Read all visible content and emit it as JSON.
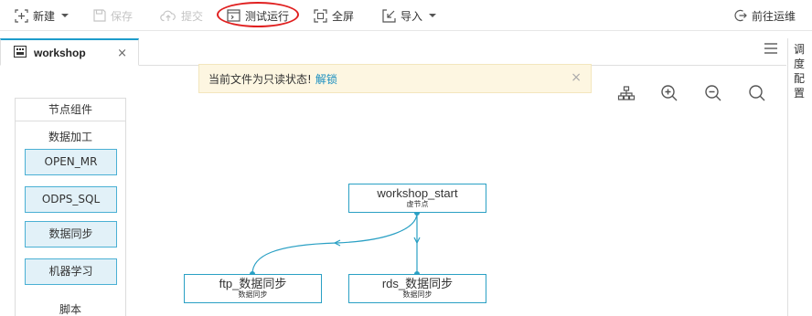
{
  "toolbar": {
    "new_label": "新建",
    "save_label": "保存",
    "submit_label": "提交",
    "test_run_label": "测试运行",
    "fullscreen_label": "全屏",
    "import_label": "导入",
    "goto_ops_label": "前往运维"
  },
  "tabs": [
    {
      "label": "workshop",
      "close": "×"
    }
  ],
  "right_panel": {
    "label": "调度配置"
  },
  "left_panel": {
    "header": "节点组件",
    "section1": "数据加工",
    "items": [
      {
        "label": "OPEN_MR"
      },
      {
        "label": "ODPS_SQL"
      },
      {
        "label": "数据同步"
      },
      {
        "label": "机器学习"
      }
    ],
    "section2": "脚本"
  },
  "notice": {
    "text": "当前文件为只读状态!",
    "link": "解锁",
    "close": "×"
  },
  "canvas": {
    "tools": [
      "layout-tree-icon",
      "zoom-in-icon",
      "zoom-out-icon",
      "search-icon"
    ],
    "nodes": [
      {
        "id": "start",
        "title": "workshop_start",
        "subtitle": "虚节点"
      },
      {
        "id": "ftp",
        "title": "ftp_数据同步",
        "subtitle": "数据同步"
      },
      {
        "id": "rds",
        "title": "rds_数据同步",
        "subtitle": "数据同步"
      }
    ],
    "edges": [
      {
        "from": "start",
        "to": "ftp"
      },
      {
        "from": "start",
        "to": "rds"
      }
    ]
  },
  "colors": {
    "accent": "#1e9ccb",
    "node_border": "#2aa0c4",
    "component_fill": "#e2f1f8",
    "notice_bg": "#fdf6e1",
    "highlight": "#e02020",
    "link": "#1a8fc0"
  }
}
